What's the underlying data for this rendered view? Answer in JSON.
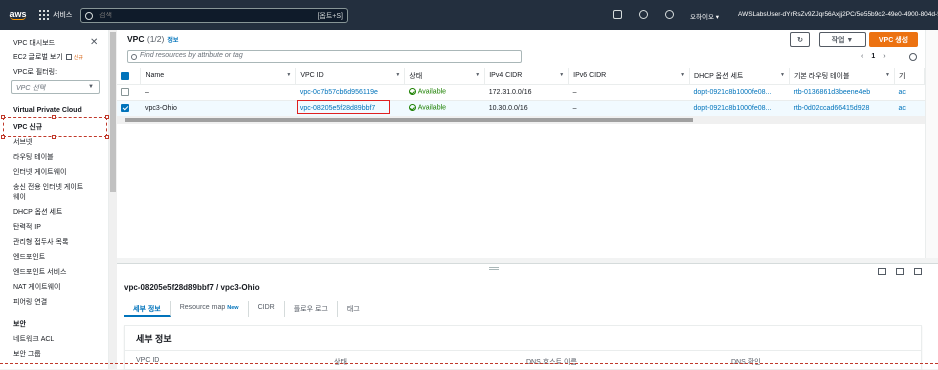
{
  "topbar": {
    "logo": "aws",
    "services_label": "서비스",
    "search_placeholder": "검색",
    "search_shortcut": "[옵트+S]",
    "region": "오하이오 ▾",
    "account": "AWSLabsUser-dYrRsZv9ZJqr56Axjj2PC/5e55b9c2-49e0-4900-804d-530"
  },
  "sidebar": {
    "dashboard": "VPC 대시보드",
    "global_view": "EC2 글로벌 보기",
    "global_view_badge": "신규",
    "filter_label": "VPC로 필터링:",
    "filter_placeholder": "VPC 선택",
    "section": "Virtual Private Cloud",
    "items": [
      "VPC 신규",
      "서브넷",
      "라우팅 테이블",
      "인터넷 게이트웨이",
      "송신 전용 인터넷 게이트",
      "웨이",
      "DHCP 옵션 세트",
      "탄력적 IP",
      "관리형 접두사 목록",
      "엔드포인트",
      "엔드포인트 서비스",
      "NAT 게이트웨이",
      "피어링 연결"
    ],
    "security_section": "보안",
    "security_items": [
      "네트워크 ACL",
      "보안 그룹"
    ]
  },
  "panel": {
    "title": "VPC",
    "count": "(1/2)",
    "info": "정보",
    "actions_label": "작업 ▼",
    "create_label": "VPC 생성",
    "search_placeholder": "Find resources by attribute or tag",
    "page": "1",
    "columns": [
      "Name",
      "VPC ID",
      "상태",
      "IPv4 CIDR",
      "IPv6 CIDR",
      "DHCP 옵션 세트",
      "기본 라우팅 테이블",
      "기"
    ],
    "rows": [
      {
        "name": "–",
        "vpc_id": "vpc-0c7b57cb6d956119e",
        "status": "Available",
        "ipv4": "172.31.0.0/16",
        "ipv6": "–",
        "dhcp": "dopt-0921c8b1000fe08...",
        "rtb": "rtb-0136861d3beene4eb",
        "extra": "ac"
      },
      {
        "name": "vpc3-Ohio",
        "vpc_id": "vpc-08205e5f28d89bbf7",
        "status": "Available",
        "ipv4": "10.30.0.0/16",
        "ipv6": "–",
        "dhcp": "dopt-0921c8b1000fe08...",
        "rtb": "rtb-0d02ccad66415d928",
        "extra": "ac"
      }
    ]
  },
  "detail": {
    "title": "vpc-08205e5f28d89bbf7 / vpc3-Ohio",
    "tabs": [
      "세부 정보",
      "Resource map",
      "CIDR",
      "플로우 로그",
      "태그"
    ],
    "new_badge": "New",
    "card_title": "세부 정보",
    "fields": [
      "VPC ID",
      "상태",
      "DNS 호스트 이름",
      "DNS 확인"
    ]
  }
}
